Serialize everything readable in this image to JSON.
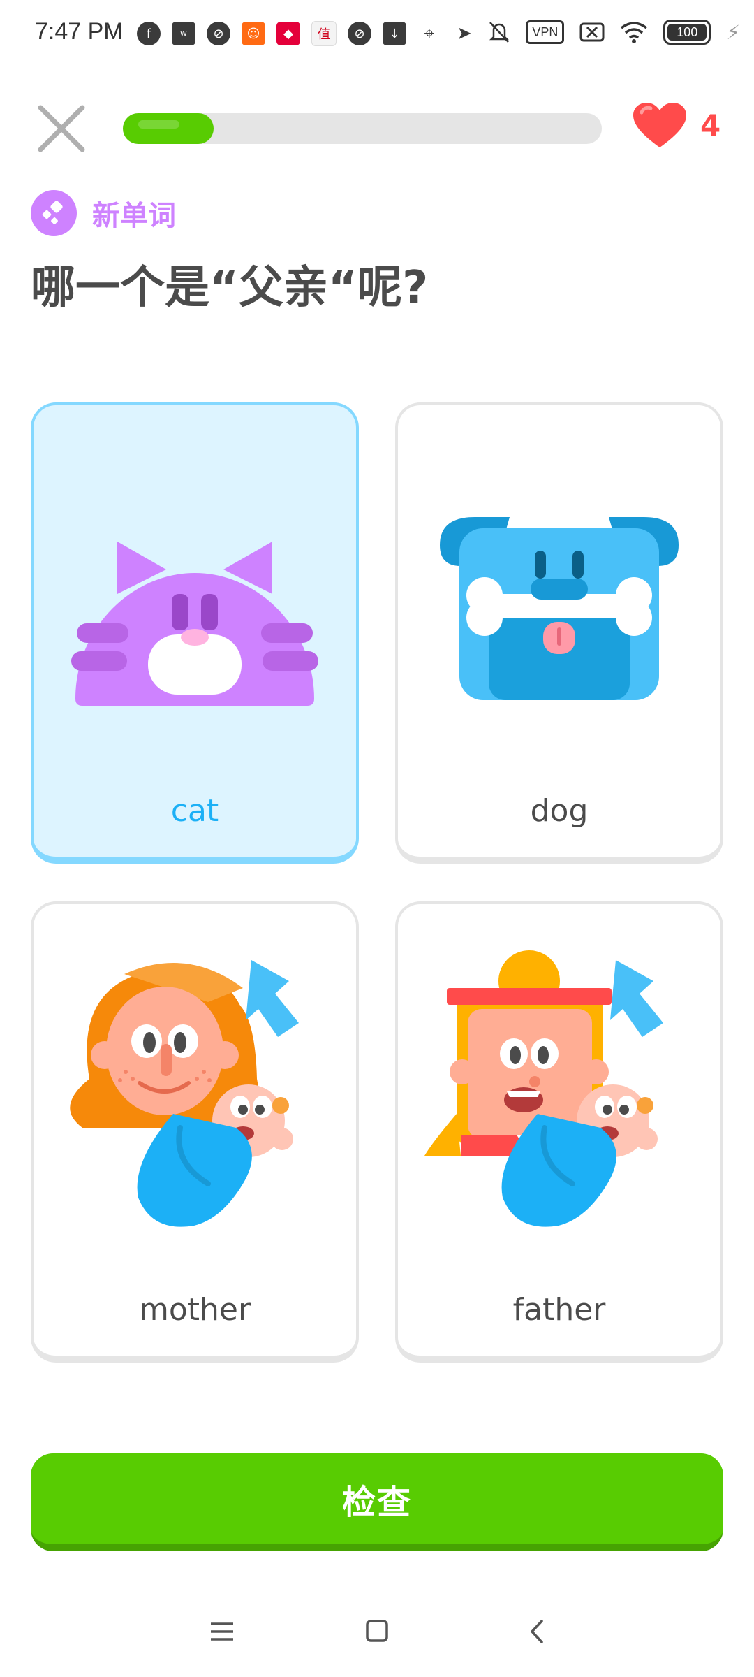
{
  "status_bar": {
    "time": "7:47 PM",
    "vpn_label": "VPN",
    "battery": "100"
  },
  "header": {
    "progress": 0.19,
    "hearts": "4",
    "colors": {
      "progress": "#58cc02",
      "heart": "#ff4b4b"
    }
  },
  "prompt": {
    "badge_label": "新单词",
    "question": "哪一个是“父亲“呢?"
  },
  "options": [
    {
      "label": "cat",
      "icon": "cat-icon",
      "selected": true
    },
    {
      "label": "dog",
      "icon": "dog-icon",
      "selected": false
    },
    {
      "label": "mother",
      "icon": "mother-icon",
      "selected": false
    },
    {
      "label": "father",
      "icon": "father-icon",
      "selected": false
    }
  ],
  "check_button": {
    "label": "检查"
  },
  "nav": {
    "icons": [
      "menu-icon",
      "home-icon",
      "back-icon"
    ]
  },
  "colors": {
    "selected_bg": "#ddf4ff",
    "selected_border": "#84d8ff",
    "selected_text": "#1cb0f6",
    "badge": "#ce82ff",
    "check": "#58cc02"
  }
}
